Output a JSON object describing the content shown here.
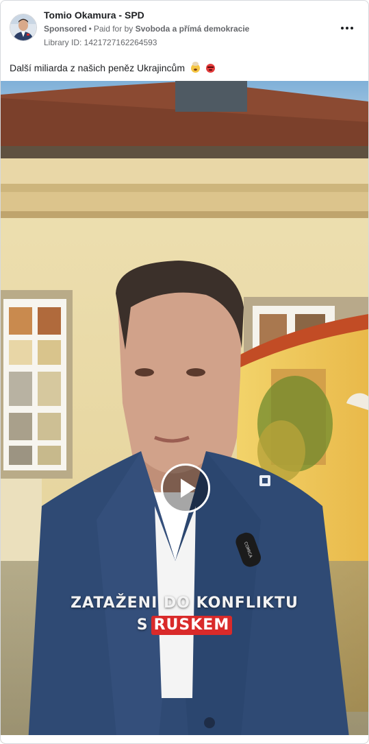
{
  "post": {
    "page_name": "Tomio Okamura - SPD",
    "sponsored_label": "Sponsored",
    "separator": "•",
    "paid_for_prefix": "Paid for by",
    "payer": "Svoboda a přímá demokracie",
    "library_id": "Library ID: 1421727162264593",
    "caption": "Další miliarda z našich peněz Ukrajincům",
    "caption_emojis": [
      "exploding-head-emoji",
      "angry-face-emoji"
    ]
  },
  "video": {
    "subtitle_line1": "ZATAŽENI DO KONFLIKTU",
    "subtitle_line2_prefix": "S",
    "subtitle_line2_highlight": "RUSKEM",
    "highlight_color": "#d92a2a",
    "microphone_label": "COMICA"
  },
  "icons": {
    "more": "more-options-icon",
    "play": "play-icon"
  }
}
